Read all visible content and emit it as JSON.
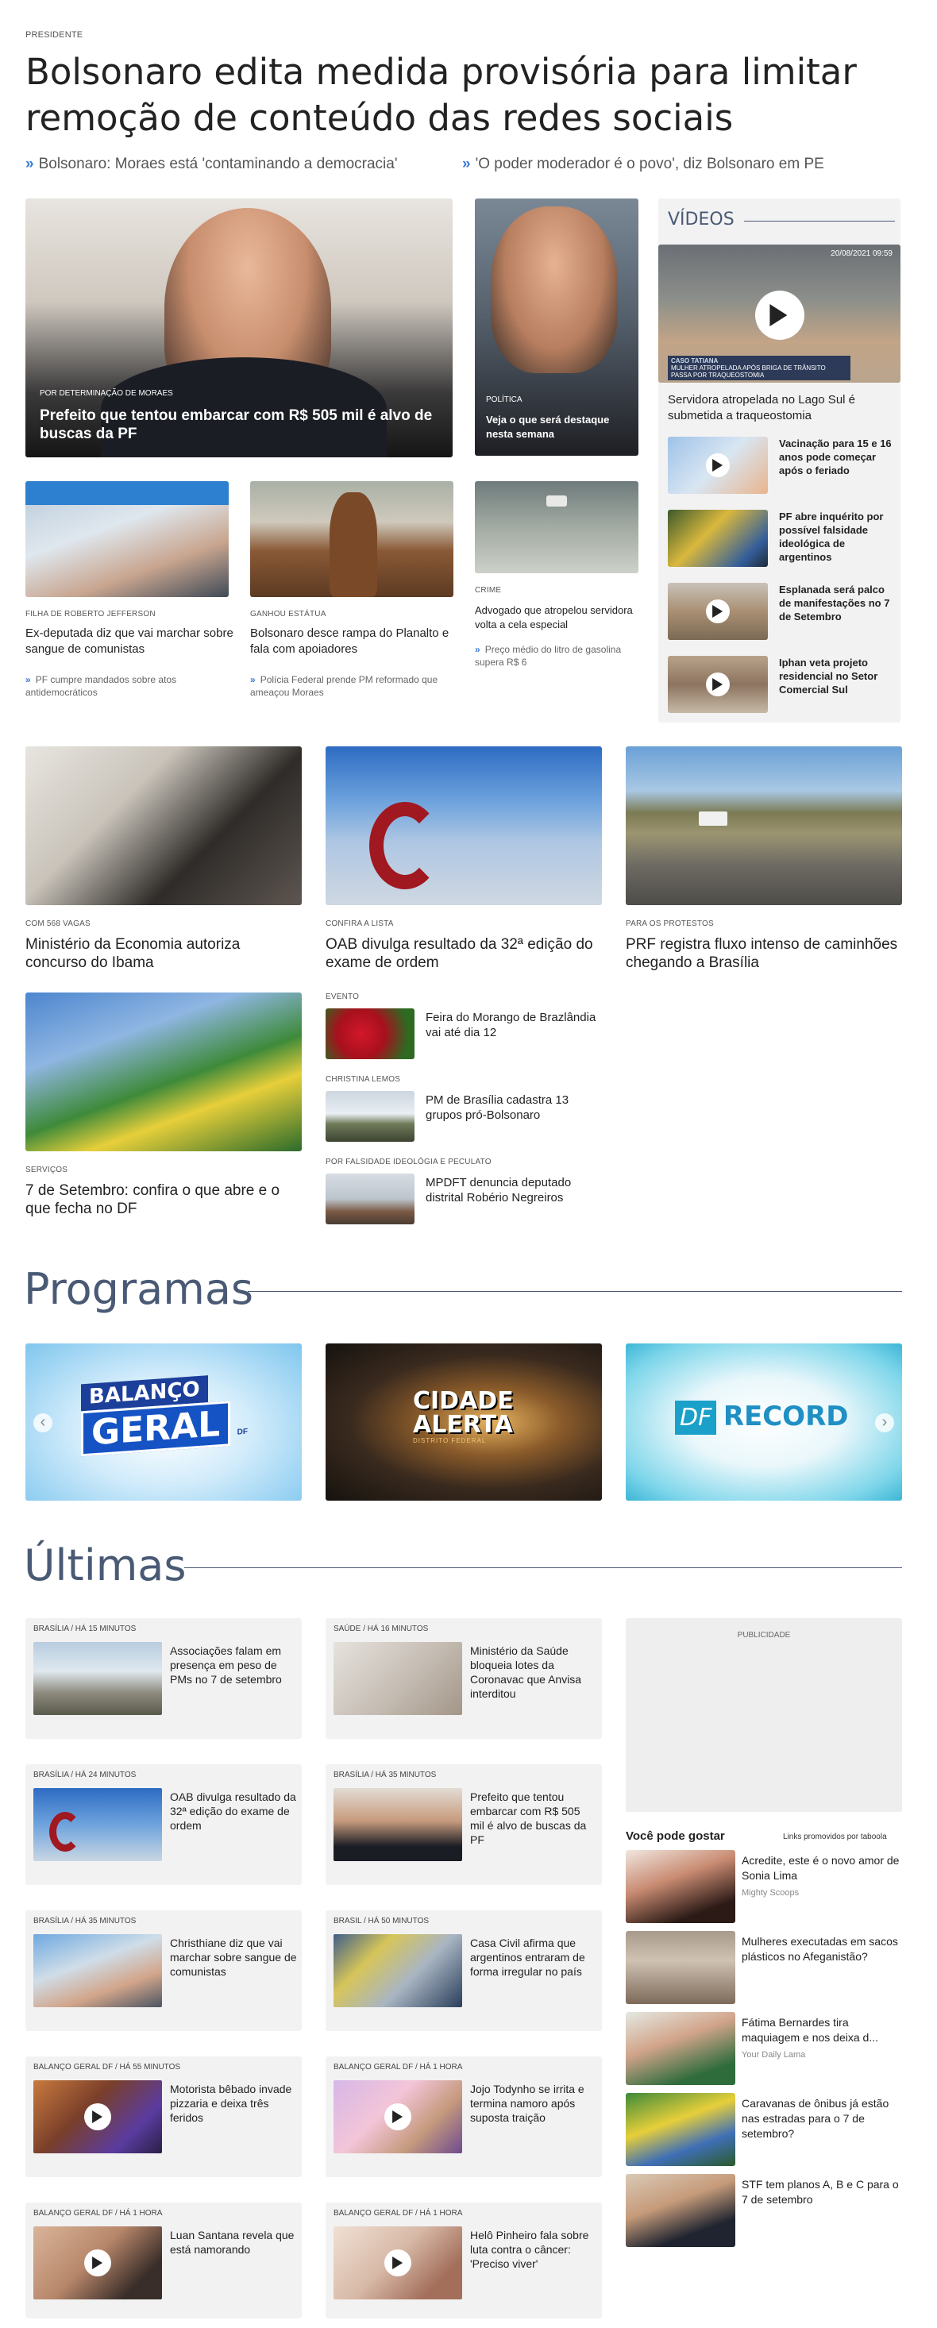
{
  "hero": {
    "kicker": "PRESIDENTE",
    "headline": "Bolsonaro edita medida provisória para limitar remoção de conteúdo das redes sociais",
    "related": [
      "Bolsonaro: Moraes está 'contaminando a democracia'",
      "'O poder moderador é o povo', diz Bolsonaro em PE"
    ]
  },
  "feature_main": {
    "kicker": "POR DETERMINAÇÃO DE MORAES",
    "title": "Prefeito que tentou embarcar com R$ 505 mil é alvo de buscas da PF"
  },
  "feature_side": {
    "kicker": "POLÍTICA",
    "title": "Veja o que será destaque nesta semana"
  },
  "row2": [
    {
      "kicker": "FILHA DE ROBERTO JEFFERSON",
      "title": "Ex-deputada diz que vai marchar sobre sangue de comunistas",
      "sub": "PF cumpre mandados sobre atos antidemocráticos"
    },
    {
      "kicker": "GANHOU ESTÁTUA",
      "title": "Bolsonaro desce rampa do Planalto e fala com apoiadores",
      "sub": "Polícia Federal prende PM reformado que ameaçou Moraes"
    },
    {
      "kicker": "CRIME",
      "title": "Advogado que atropelou servidora volta a cela especial",
      "sub": "Preço médio do litro de gasolina supera R$ 6"
    }
  ],
  "videos": {
    "title": "VÍDEOS",
    "main": {
      "overlay_line1": "CASO TATIANA",
      "overlay_line2": "MULHER ATROPELADA APÓS BRIGA DE TRÂNSITO PASSA POR TRAQUEOSTOMIA",
      "timestamp": "20/08/2021 09:59",
      "title": "Servidora atropelada no Lago Sul é submetida a traqueostomia"
    },
    "items": [
      {
        "title": "Vacinação para 15 e 16 anos pode começar após o feriado"
      },
      {
        "title": "PF abre inquérito por possível falsidade ideológica de argentinos"
      },
      {
        "title": "Esplanada será palco de manifestações no 7 de Setembro"
      },
      {
        "title": "Iphan veta projeto residencial no Setor Comercial Sul"
      }
    ]
  },
  "grid3": [
    {
      "kicker": "COM 568 VAGAS",
      "title": "Ministério da Economia autoriza concurso do Ibama"
    },
    {
      "kicker": "CONFIRA A LISTA",
      "title": "OAB divulga resultado da 32ª edição do exame de ordem"
    },
    {
      "kicker": "PARA OS PROTESTOS",
      "title": "PRF registra fluxo intenso de caminhões chegando a Brasília"
    }
  ],
  "services": {
    "kicker": "SERVIÇOS",
    "title": "7 de Setembro: confira o que abre e o que fecha no DF"
  },
  "small_list": [
    {
      "kicker": "EVENTO",
      "title": "Feira do Morango de Brazlândia vai até dia 12"
    },
    {
      "kicker": "CHRISTINA LEMOS",
      "title": "PM de Brasília cadastra 13 grupos pró-Bolsonaro"
    },
    {
      "kicker": "POR FALSIDADE IDEOLÓGIA E PECULATO",
      "title": "MPDFT denuncia deputado distrital Robério Negreiros"
    }
  ],
  "programas": {
    "title": "Programas",
    "items": [
      {
        "logo_line1": "BALANÇO",
        "logo_line2": "GERAL",
        "logo_tag": "DF"
      },
      {
        "logo_line1": "CIDADE",
        "logo_line2": "ALERTA",
        "logo_tag": "DISTRITO FEDERAL"
      },
      {
        "logo_prefix": "DF",
        "logo_main": "RECORD"
      }
    ],
    "prev_arrow": "‹",
    "next_arrow": "›"
  },
  "ultimas": {
    "title": "Últimas",
    "cards": [
      {
        "kicker": "BRASÍLIA / HÁ 15 MINUTOS",
        "title": "Associações falam em presença em peso de PMs no 7 de setembro",
        "video": false
      },
      {
        "kicker": "SAÚDE / HÁ 16 MINUTOS",
        "title": "Ministério da Saúde bloqueia lotes da Coronavac que Anvisa interditou",
        "video": false
      },
      {
        "kicker": "BRASÍLIA / HÁ 24 MINUTOS",
        "title": "OAB divulga resultado da 32ª edição do exame de ordem",
        "video": false
      },
      {
        "kicker": "BRASÍLIA / HÁ 35 MINUTOS",
        "title": "Prefeito que tentou embarcar com R$ 505 mil é alvo de buscas da PF",
        "video": false
      },
      {
        "kicker": "BRASÍLIA / HÁ 35 MINUTOS",
        "title": "Christhiane diz que vai marchar sobre sangue de comunistas",
        "video": false
      },
      {
        "kicker": "BRASIL / HÁ 50 MINUTOS",
        "title": "Casa Civil afirma que argentinos entraram de forma irregular no país",
        "video": false
      },
      {
        "kicker": "BALANÇO GERAL DF / HÁ 55 MINUTOS",
        "title": "Motorista bêbado invade pizzaria e deixa três feridos",
        "video": true
      },
      {
        "kicker": "BALANÇO GERAL DF / HÁ 1 HORA",
        "title": "Jojo Todynho se irrita e termina namoro após suposta traição",
        "video": true
      },
      {
        "kicker": "BALANÇO GERAL DF / HÁ 1 HORA",
        "title": "Luan Santana revela que está namorando",
        "video": true
      },
      {
        "kicker": "BALANÇO GERAL DF / HÁ 1 HORA",
        "title": "Helô Pinheiro fala sobre luta contra o câncer: 'Preciso viver'",
        "video": true
      }
    ]
  },
  "ad": {
    "label": "PUBLICIDADE"
  },
  "taboola": {
    "title": "Você pode gostar",
    "promo": "Links promovidos por taboola",
    "items": [
      {
        "title": "Acredite, este é o novo amor de Sonia Lima",
        "source": "Mighty Scoops"
      },
      {
        "title": "Mulheres executadas em sacos plásticos no Afeganistão?",
        "source": ""
      },
      {
        "title": "Fátima Bernardes tira maquiagem e nos deixa d...",
        "source": "Your Daily Lama"
      },
      {
        "title": "Caravanas de ônibus já estão nas estradas para o 7 de setembro?",
        "source": ""
      },
      {
        "title": "STF tem planos A, B e C para o 7 de setembro",
        "source": ""
      }
    ]
  }
}
